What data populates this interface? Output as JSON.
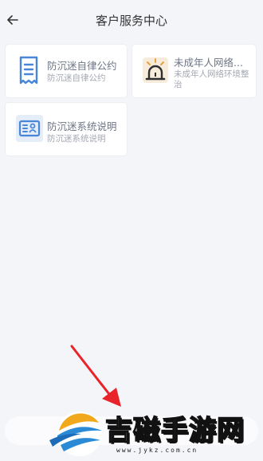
{
  "header": {
    "title": "客户服务中心",
    "back_icon": "arrow-left-icon"
  },
  "cards": [
    {
      "title": "防沉迷自律公约",
      "subtitle": "防沉迷自律公约",
      "icon": "document-icon",
      "icon_color": "#4a86d8"
    },
    {
      "title": "未成年人网络...",
      "subtitle": "未成年人网络环境整治",
      "icon": "alarm-siren-icon",
      "icon_color": "#e8a23c"
    },
    {
      "title": "防沉迷系统说明",
      "subtitle": "防沉迷系统说明",
      "icon": "id-card-icon",
      "icon_color": "#4a86d8"
    }
  ],
  "watermark": {
    "brand": "吉磁手游网",
    "url": "www.jykz.com.cn",
    "partial": "j"
  },
  "colors": {
    "background": "#f4f5f8",
    "card": "#ffffff",
    "annotation_arrow": "#e8232a"
  }
}
